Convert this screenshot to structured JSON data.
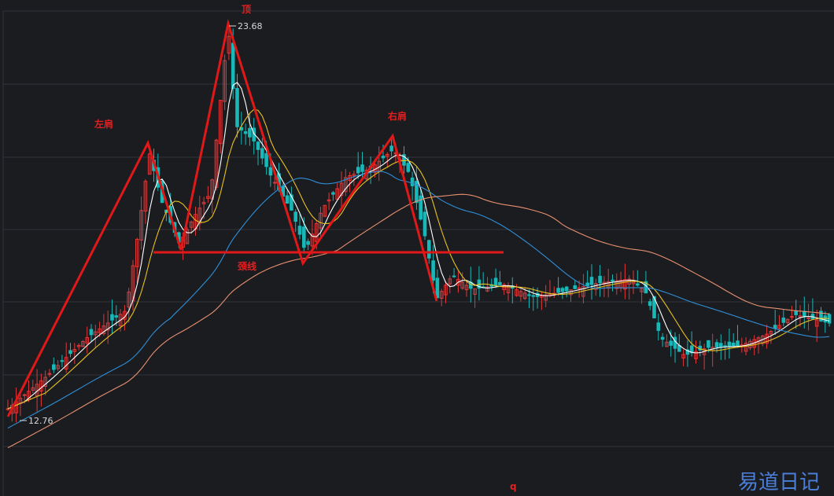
{
  "chart_data": {
    "type": "candlestick",
    "title": "",
    "grid": true,
    "annotations": {
      "left_shoulder": "左肩",
      "head": "顶",
      "right_shoulder": "右肩",
      "neckline": "颈线",
      "bottom_mark": "q"
    },
    "price_labels": {
      "high": "23.68",
      "low": "12.76"
    },
    "high_value": 23.68,
    "low_value": 12.76,
    "series": [
      {
        "kind": "ma",
        "color": "#ffffff"
      },
      {
        "kind": "ma",
        "color": "#e8c020"
      },
      {
        "kind": "ma",
        "color": "#2e8fd8"
      },
      {
        "kind": "ma",
        "color": "#e89070"
      }
    ],
    "colors": {
      "up": "#e03838",
      "down": "#18b8b8",
      "grid": "#33343a",
      "pattern": "#e01818",
      "background": "#1b1c20"
    }
  },
  "watermark": "易道日记"
}
